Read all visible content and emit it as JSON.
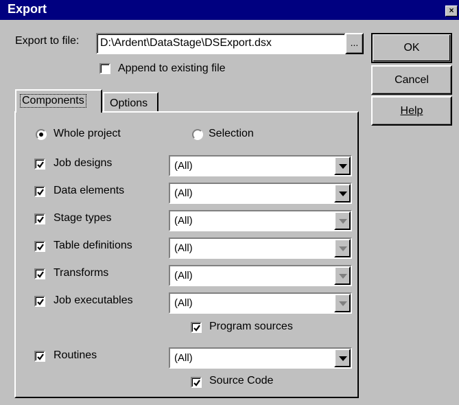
{
  "window": {
    "title": "Export",
    "close_glyph": "×"
  },
  "export": {
    "label": "Export to file:",
    "path": "D:\\Ardent\\DataStage\\DSExport.dsx",
    "browse_label": "...",
    "append_label": "Append to existing file",
    "append_checked": false
  },
  "buttons": {
    "ok": "OK",
    "cancel": "Cancel",
    "help": "Help"
  },
  "tabs": [
    {
      "label": "Components",
      "active": true
    },
    {
      "label": "Options",
      "active": false
    }
  ],
  "scope": {
    "whole_project": "Whole project",
    "selection": "Selection",
    "selected": "whole_project"
  },
  "components": [
    {
      "label": "Job designs",
      "checked": true,
      "value": "(All)",
      "enabled": true
    },
    {
      "label": "Data elements",
      "checked": true,
      "value": "(All)",
      "enabled": true
    },
    {
      "label": "Stage types",
      "checked": true,
      "value": "(All)",
      "enabled": false
    },
    {
      "label": "Table definitions",
      "checked": true,
      "value": "(All)",
      "enabled": false
    },
    {
      "label": "Transforms",
      "checked": true,
      "value": "(All)",
      "enabled": false
    },
    {
      "label": "Job executables",
      "checked": true,
      "value": "(All)",
      "enabled": false
    },
    {
      "label": "Routines",
      "checked": true,
      "value": "(All)",
      "enabled": true
    }
  ],
  "program_sources": {
    "label": "Program sources",
    "checked": true
  },
  "source_code": {
    "label": "Source Code",
    "checked": true
  },
  "icons": {
    "check": "checkmark-icon",
    "dropdown": "chevron-down-icon",
    "close": "close-icon"
  }
}
